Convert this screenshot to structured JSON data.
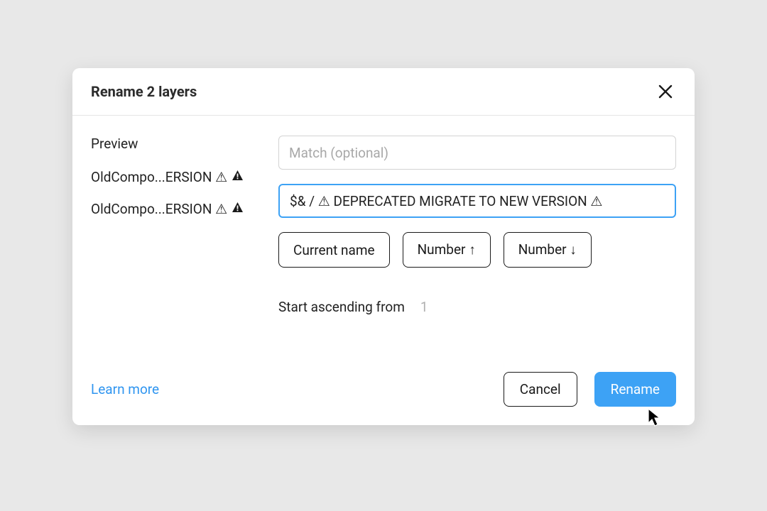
{
  "dialog": {
    "title": "Rename 2 layers",
    "preview_label": "Preview",
    "preview_items": [
      "OldCompo...ERSION ⚠",
      "OldCompo...ERSION ⚠"
    ],
    "match_placeholder": "Match (optional)",
    "rename_value": "$& / ⚠ DEPRECATED MIGRATE TO NEW VERSION ⚠",
    "chips": {
      "current_name": "Current name",
      "number_asc": "Number ↑",
      "number_desc": "Number ↓"
    },
    "start_ascending_label": "Start ascending from",
    "start_ascending_value": "1",
    "learn_more": "Learn more",
    "cancel_label": "Cancel",
    "rename_label": "Rename"
  },
  "icons": {
    "warning": "⚠"
  }
}
